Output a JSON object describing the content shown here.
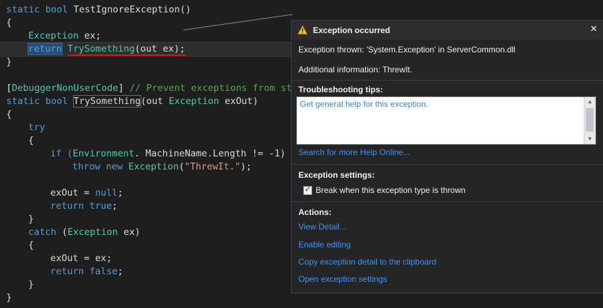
{
  "code": {
    "l1": {
      "a": "static bool ",
      "b": "TestIgnoreException()"
    },
    "l2": "{",
    "l3": {
      "type": "Exception",
      "rest": " ex;"
    },
    "l4": {
      "kw": "return",
      "fn": "TrySomething",
      "rest": "(out ex);"
    },
    "l5": "}",
    "l7": {
      "attr_open": "[",
      "attr": "DebuggerNonUserCode",
      "attr_close": "] ",
      "comment": "// Prevent exceptions from sto"
    },
    "l8": {
      "a": "static bool ",
      "fn": "TrySomething",
      "b": "(out ",
      "type": "Exception",
      "c": " exOut)"
    },
    "l9": "{",
    "l10": "try",
    "l11": "{",
    "l12": {
      "a": "if (",
      "type": "Environment",
      "b": ". MachineName.Length != -1)"
    },
    "l13": {
      "a": "throw new ",
      "type": "Exception",
      "b": "(",
      "str": "\"ThrewIt.\"",
      "c": ");"
    },
    "l15": {
      "a": "exOut = ",
      "kw": "null",
      "b": ";"
    },
    "l16": {
      "kw": "return true",
      "b": ";"
    },
    "l17": "}",
    "l18": {
      "kw": "catch",
      "b": " (",
      "type": "Exception",
      "c": " ex)"
    },
    "l19": "{",
    "l20": {
      "a": "exOut = ex;"
    },
    "l21": {
      "kw": "return false",
      "b": ";"
    },
    "l22": "}",
    "l23": "}"
  },
  "popup": {
    "title": "Exception occurred",
    "thrown": "Exception thrown: 'System.Exception' in ServerCommon.dll",
    "additional": "Additional information: ThrewIt.",
    "troubleshooting_heading": "Troubleshooting tips:",
    "tip_link": "Get general help for this exception.",
    "search_link": "Search for more Help Online...",
    "settings_heading": "Exception settings:",
    "break_checkbox_label": "Break when this exception type is thrown",
    "break_checked": true,
    "actions_heading": "Actions:",
    "actions": [
      "View Detail...",
      "Enable editing",
      "Copy exception detail to the clipboard",
      "Open exception settings"
    ]
  },
  "colors": {
    "background": "#1e1e1e",
    "keyword": "#569cd6",
    "type": "#4ec9b0",
    "comment": "#57a64a",
    "string": "#d69d85",
    "link": "#3794ff",
    "warning": "#f5c518"
  }
}
